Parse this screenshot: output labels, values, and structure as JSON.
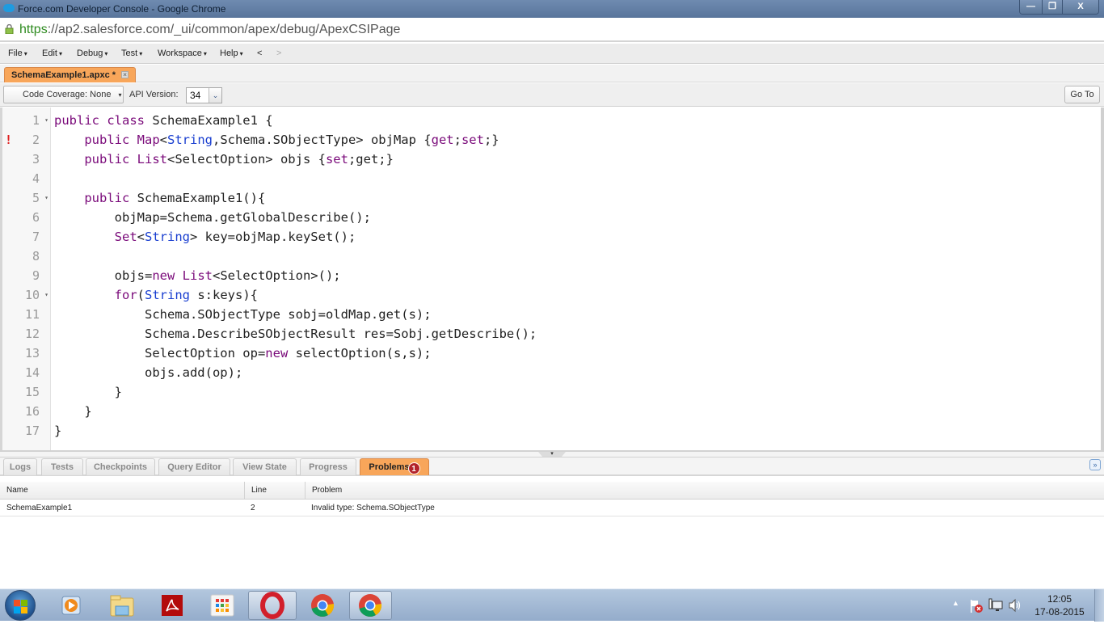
{
  "window": {
    "title": "Force.com Developer Console - Google Chrome",
    "controls": {
      "minimize": "—",
      "restore": "❐",
      "close": "X"
    }
  },
  "address_bar": {
    "scheme": "https",
    "rest": "://ap2.salesforce.com/_ui/common/apex/debug/ApexCSIPage"
  },
  "menu": {
    "items": [
      {
        "label": "File",
        "arrow": "▾"
      },
      {
        "label": "Edit",
        "arrow": "▾"
      },
      {
        "label": "Debug",
        "arrow": "▾"
      },
      {
        "label": "Test",
        "arrow": "▾"
      },
      {
        "label": "Workspace",
        "arrow": "▾"
      },
      {
        "label": "Help",
        "arrow": "▾"
      }
    ],
    "back": "<",
    "forward": ">"
  },
  "file_tab": {
    "label": "SchemaExample1.apxc *",
    "close": "×"
  },
  "toolbar": {
    "code_coverage": "Code Coverage: None",
    "coverage_arrow": "▾",
    "api_label": "API Version:",
    "api_value": "34",
    "api_arrow": "⌄",
    "goto": "Go To"
  },
  "editor": {
    "error_marker": "!",
    "fold_marker": "▾",
    "lines": [
      {
        "num": "1",
        "fold": true,
        "error": false
      },
      {
        "num": "2",
        "fold": false,
        "error": true
      },
      {
        "num": "3",
        "fold": false,
        "error": false
      },
      {
        "num": "4",
        "fold": false,
        "error": false
      },
      {
        "num": "5",
        "fold": true,
        "error": false
      },
      {
        "num": "6",
        "fold": false,
        "error": false
      },
      {
        "num": "7",
        "fold": false,
        "error": false
      },
      {
        "num": "8",
        "fold": false,
        "error": false
      },
      {
        "num": "9",
        "fold": false,
        "error": false
      },
      {
        "num": "10",
        "fold": true,
        "error": false
      },
      {
        "num": "11",
        "fold": false,
        "error": false
      },
      {
        "num": "12",
        "fold": false,
        "error": false
      },
      {
        "num": "13",
        "fold": false,
        "error": false
      },
      {
        "num": "14",
        "fold": false,
        "error": false
      },
      {
        "num": "15",
        "fold": false,
        "error": false
      },
      {
        "num": "16",
        "fold": false,
        "error": false
      },
      {
        "num": "17",
        "fold": false,
        "error": false
      }
    ],
    "code": [
      [
        [
          "k",
          "public class "
        ],
        [
          "p",
          "SchemaExample1 {"
        ]
      ],
      [
        [
          "p",
          "    "
        ],
        [
          "k",
          "public Map"
        ],
        [
          "p",
          "<"
        ],
        [
          "t",
          "String"
        ],
        [
          "p",
          ",Schema.SObjectType> objMap {"
        ],
        [
          "k",
          "get"
        ],
        [
          "p",
          ";"
        ],
        [
          "k",
          "set"
        ],
        [
          "p",
          ";}"
        ]
      ],
      [
        [
          "p",
          "    "
        ],
        [
          "k",
          "public List"
        ],
        [
          "p",
          "<SelectOption> objs {"
        ],
        [
          "k",
          "set"
        ],
        [
          "p",
          ";get;}"
        ]
      ],
      [],
      [
        [
          "p",
          "    "
        ],
        [
          "k",
          "public "
        ],
        [
          "p",
          "SchemaExample1(){"
        ]
      ],
      [
        [
          "p",
          "        objMap=Schema.getGlobalDescribe();"
        ]
      ],
      [
        [
          "p",
          "        "
        ],
        [
          "k",
          "Set"
        ],
        [
          "p",
          "<"
        ],
        [
          "t",
          "String"
        ],
        [
          "p",
          "> key=objMap.keySet();"
        ]
      ],
      [],
      [
        [
          "p",
          "        objs="
        ],
        [
          "k",
          "new List"
        ],
        [
          "p",
          "<SelectOption>();"
        ]
      ],
      [
        [
          "p",
          "        "
        ],
        [
          "k",
          "for"
        ],
        [
          "p",
          "("
        ],
        [
          "t",
          "String"
        ],
        [
          "p",
          " s:keys){"
        ]
      ],
      [
        [
          "p",
          "            Schema.SObjectType sobj=oldMap.get(s);"
        ]
      ],
      [
        [
          "p",
          "            Schema.DescribeSObjectResult res=Sobj.getDescribe();"
        ]
      ],
      [
        [
          "p",
          "            SelectOption op="
        ],
        [
          "k",
          "new"
        ],
        [
          "p",
          " selectOption(s,s);"
        ]
      ],
      [
        [
          "p",
          "            objs.add(op);"
        ]
      ],
      [
        [
          "p",
          "        }"
        ]
      ],
      [
        [
          "p",
          "    }"
        ]
      ],
      [
        [
          "p",
          "}"
        ]
      ]
    ]
  },
  "bottom_tabs": [
    {
      "label": "Logs",
      "active": false
    },
    {
      "label": "Tests",
      "active": false
    },
    {
      "label": "Checkpoints",
      "active": false
    },
    {
      "label": "Query Editor",
      "active": false
    },
    {
      "label": "View State",
      "active": false
    },
    {
      "label": "Progress",
      "active": false
    },
    {
      "label": "Problems",
      "active": true,
      "badge": "1"
    }
  ],
  "problems": {
    "columns": [
      "Name",
      "Line",
      "Problem"
    ],
    "rows": [
      [
        "SchemaExample1",
        "2",
        "Invalid type: Schema.SObjectType"
      ]
    ]
  },
  "taskbar": {
    "apps": [
      "windows-media-player",
      "file-explorer",
      "adobe-reader",
      "apps-launcher",
      "opera",
      "chrome",
      "chrome-active"
    ],
    "clock_time": "12:05",
    "clock_date": "17-08-2015",
    "tray_arrow": "▲"
  },
  "colors": {
    "accent_tab": "#f8a65a",
    "keyword": "#7a0a7a",
    "type": "#1a3fd0",
    "error": "#e02020",
    "badge": "#b3232a"
  }
}
